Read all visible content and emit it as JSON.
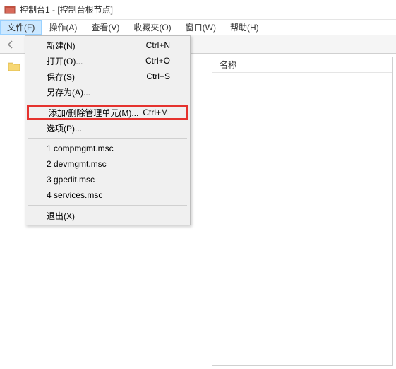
{
  "title": "控制台1 - [控制台根节点]",
  "menubar": {
    "file": "文件(F)",
    "action": "操作(A)",
    "view": "查看(V)",
    "favorites": "收藏夹(O)",
    "window": "窗口(W)",
    "help": "帮助(H)"
  },
  "dropdown": {
    "new": {
      "label": "新建(N)",
      "shortcut": "Ctrl+N"
    },
    "open": {
      "label": "打开(O)...",
      "shortcut": "Ctrl+O"
    },
    "save": {
      "label": "保存(S)",
      "shortcut": "Ctrl+S"
    },
    "saveAs": {
      "label": "另存为(A)...",
      "shortcut": ""
    },
    "addRemove": {
      "label": "添加/删除管理单元(M)...",
      "shortcut": "Ctrl+M"
    },
    "options": {
      "label": "选项(P)...",
      "shortcut": ""
    },
    "recent1": {
      "label": "1 compmgmt.msc",
      "shortcut": ""
    },
    "recent2": {
      "label": "2 devmgmt.msc",
      "shortcut": ""
    },
    "recent3": {
      "label": "3 gpedit.msc",
      "shortcut": ""
    },
    "recent4": {
      "label": "4 services.msc",
      "shortcut": ""
    },
    "exit": {
      "label": "退出(X)",
      "shortcut": ""
    }
  },
  "rightPane": {
    "columnHeader": "名称"
  }
}
